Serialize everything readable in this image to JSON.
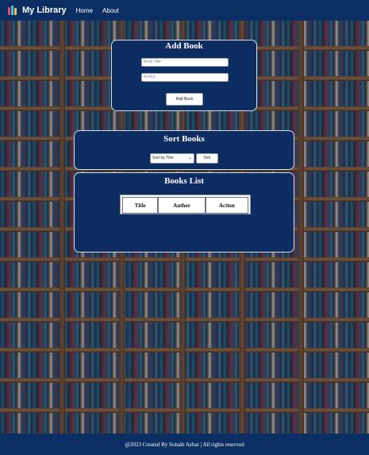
{
  "navbar": {
    "brand": "My Library",
    "links": [
      "Home",
      "About"
    ]
  },
  "add_book": {
    "title": "Add Book",
    "title_placeholder": "Book Title",
    "author_placeholder": "Author",
    "button_label": "Add Book"
  },
  "sort_books": {
    "title": "Sort Books",
    "selected_option": "Sort by Title",
    "button_label": "Sort"
  },
  "books_list": {
    "title": "Books List",
    "columns": [
      "Title",
      "Author",
      "Action"
    ]
  },
  "footer": {
    "text": "@2023 Created By Sohaib Azhar | All rights reserved"
  },
  "colors": {
    "primary": "#0c2f63",
    "card_bg": "#0d2d62"
  },
  "icons": {
    "brand": "books-icon",
    "select": "chevron-down-icon"
  }
}
